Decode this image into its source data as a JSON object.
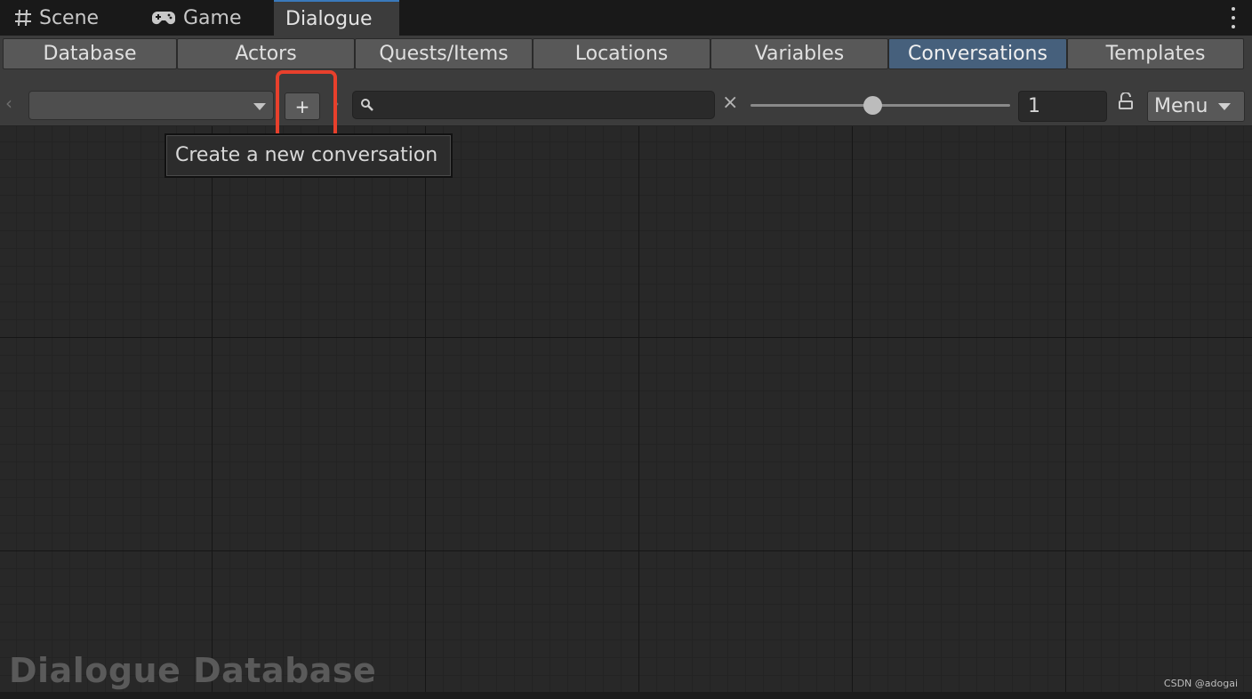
{
  "window_tabs": [
    {
      "label": "Scene",
      "icon": "grid-icon"
    },
    {
      "label": "Game",
      "icon": "gamepad-icon"
    },
    {
      "label": "Dialogue",
      "active": true
    }
  ],
  "section_tabs": [
    {
      "label": "Database"
    },
    {
      "label": "Actors"
    },
    {
      "label": "Quests/Items"
    },
    {
      "label": "Locations"
    },
    {
      "label": "Variables"
    },
    {
      "label": "Conversations",
      "active": true
    },
    {
      "label": "Templates"
    }
  ],
  "toolbar": {
    "add_label": "+",
    "conversation_selected": "",
    "search_value": "",
    "clear_glyph": "×",
    "zoom_fraction": 0.47,
    "zoom_value": "1",
    "menu_label": "Menu",
    "nav_prev": "‹",
    "nav_next": "›"
  },
  "tooltip": {
    "text": "Create a new conversation"
  },
  "canvas": {
    "title": "Dialogue Database"
  },
  "credit": "CSDN @adogai",
  "colors": {
    "accent": "#3a79bb",
    "active_tab": "#46607c",
    "highlight": "#e8402c"
  }
}
